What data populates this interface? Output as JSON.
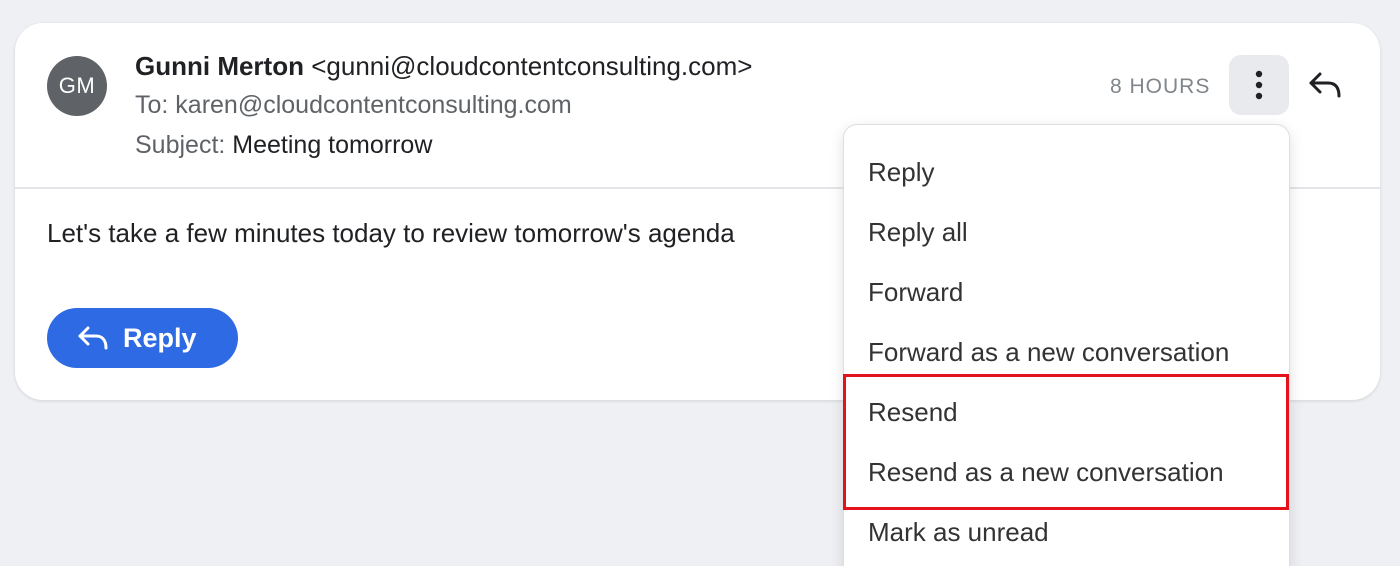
{
  "email": {
    "avatar_initials": "GM",
    "from_name": "Gunni Merton",
    "from_email": "<gunni@cloudcontentconsulting.com>",
    "to_line": "To: karen@cloudcontentconsulting.com",
    "subject_label": "Subject:",
    "subject": "Meeting tomorrow",
    "time": "8 HOURS",
    "body": "Let's take a few minutes today to review tomorrow's agenda",
    "reply_button_label": "Reply",
    "icons": {
      "more": "more-vertical-icon",
      "reply": "reply-icon"
    }
  },
  "menu": {
    "items": [
      {
        "label": "Reply"
      },
      {
        "label": "Reply all"
      },
      {
        "label": "Forward"
      },
      {
        "label": "Forward as a new conversation"
      },
      {
        "label": "Resend"
      },
      {
        "label": "Resend as a new conversation"
      },
      {
        "label": "Mark as unread"
      }
    ],
    "highlight_color": "#e3121b"
  },
  "colors": {
    "accent": "#2d6ae3",
    "background": "#eff0f4"
  }
}
